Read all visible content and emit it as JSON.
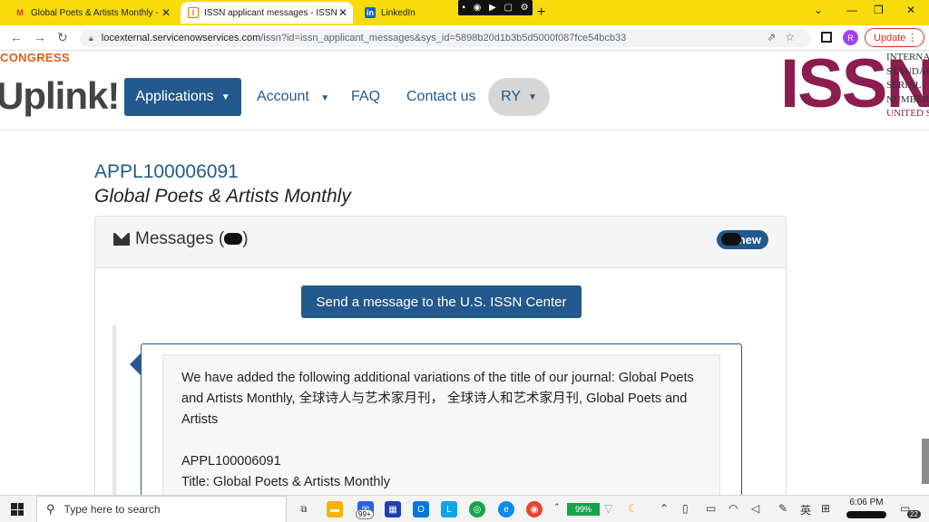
{
  "browser": {
    "tabs": [
      {
        "title": "Global Poets & Artists Monthly -",
        "close": "✕"
      },
      {
        "title": "ISSN applicant messages - ISSN",
        "close": "✕"
      },
      {
        "title": "LinkedIn"
      }
    ],
    "new_tab": "+",
    "url_host": "locexternal.servicenowservices.com",
    "url_path": "/issn?id=issn_applicant_messages&sys_id=5898b20d1b3b5d5000f087fce54bcb33",
    "profile_initial": "R",
    "update_label": "Update",
    "window_controls": [
      "⌄",
      "—",
      "❐",
      "✕"
    ]
  },
  "site": {
    "org_label": "CONGRESS",
    "logo_text": "Uplink!",
    "nav": {
      "applications": "Applications",
      "account": "Account",
      "faq": "FAQ",
      "contact": "Contact us",
      "user": "RY"
    },
    "issn_logo": "ISSN",
    "issn_lines": [
      "INTERNA",
      "STANDAR",
      "SERIAL",
      "NUMBER",
      "UNITED S"
    ]
  },
  "application": {
    "id": "APPL100006091",
    "title": "Global Poets & Artists Monthly"
  },
  "messages": {
    "heading_prefix": "Messages (",
    "heading_suffix": ")",
    "new_badge": "new",
    "send_button": "Send a message to the U.S. ISSN Center",
    "body_line1": "We have added the following additional variations of the title of our journal: Global Poets and Artists Monthly, 全球诗人与艺术家月刊，  全球诗人和艺术家月刊, Global Poets and Artists",
    "body_line2": "APPL100006091",
    "body_line3": "Title: Global Poets & Artists Monthly"
  },
  "taskbar": {
    "search_placeholder": "Type here to search",
    "mail_badge": "99+",
    "battery": "99%",
    "ime": "英",
    "time": "6:06 PM",
    "notifications": "22"
  },
  "colors": {
    "tabstrip": "#f7db0a",
    "primary": "#23598c",
    "issn_brand": "#8b1d4f",
    "congress_orange": "#e35c12"
  }
}
